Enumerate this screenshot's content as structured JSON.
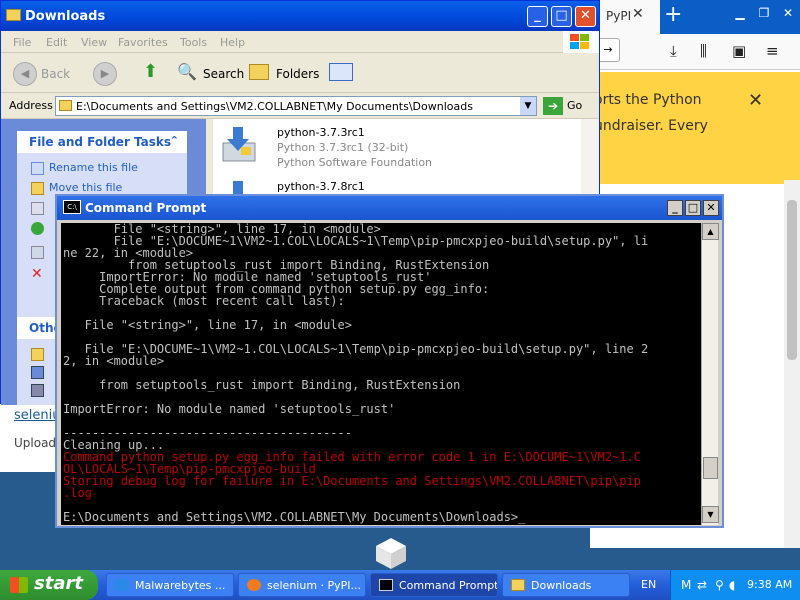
{
  "browser": {
    "tab_label": "PyPI",
    "banner_line1": "orts the Python",
    "banner_line2": "undraiser. Every",
    "link_text": "seleniu",
    "upload_text": "Uploade"
  },
  "explorer": {
    "title": "Downloads",
    "menu": [
      "File",
      "Edit",
      "View",
      "Favorites",
      "Tools",
      "Help"
    ],
    "toolbar": {
      "back": "Back",
      "search": "Search",
      "folders": "Folders"
    },
    "address_label": "Address",
    "address_value": "E:\\Documents and Settings\\VM2.COLLABNET\\My Documents\\Downloads",
    "go_label": "Go",
    "tasks_title": "File and Folder Tasks",
    "tasks": [
      "Rename this file",
      "Move this file"
    ],
    "other_title": "Othe",
    "files": [
      {
        "name": "python-3.7.3rc1",
        "desc": "Python 3.7.3rc1 (32-bit)",
        "publisher": "Python Software Foundation"
      },
      {
        "name": "python-3.7.8rc1",
        "desc": "",
        "publisher": ""
      }
    ]
  },
  "cmd": {
    "title": "Command Prompt",
    "lines": [
      {
        "t": "       File \"<string>\", line 17, in <module>",
        "c": "n"
      },
      {
        "t": "       File \"E:\\DOCUME~1\\VM2~1.COL\\LOCALS~1\\Temp\\pip-pmcxpjeo-build\\setup.py\", li",
        "c": "n"
      },
      {
        "t": "ne 22, in <module>",
        "c": "n"
      },
      {
        "t": "         from setuptools_rust import Binding, RustExtension",
        "c": "n"
      },
      {
        "t": "     ImportError: No module named 'setuptools_rust'",
        "c": "n"
      },
      {
        "t": "     Complete output from command python setup.py egg_info:",
        "c": "n"
      },
      {
        "t": "     Traceback (most recent call last):",
        "c": "n"
      },
      {
        "t": "",
        "c": "n"
      },
      {
        "t": "   File \"<string>\", line 17, in <module>",
        "c": "n"
      },
      {
        "t": "",
        "c": "n"
      },
      {
        "t": "   File \"E:\\DOCUME~1\\VM2~1.COL\\LOCALS~1\\Temp\\pip-pmcxpjeo-build\\setup.py\", line 2",
        "c": "n"
      },
      {
        "t": "2, in <module>",
        "c": "n"
      },
      {
        "t": "",
        "c": "n"
      },
      {
        "t": "     from setuptools_rust import Binding, RustExtension",
        "c": "n"
      },
      {
        "t": "",
        "c": "n"
      },
      {
        "t": "ImportError: No module named 'setuptools_rust'",
        "c": "n"
      },
      {
        "t": "",
        "c": "n"
      },
      {
        "t": "----------------------------------------",
        "c": "n"
      },
      {
        "t": "Cleaning up...",
        "c": "n"
      },
      {
        "t": "Command python setup.py egg_info failed with error code 1 in E:\\DOCUME~1\\VM2~1.C",
        "c": "e"
      },
      {
        "t": "OL\\LOCALS~1\\Temp\\pip-pmcxpjeo-build",
        "c": "e"
      },
      {
        "t": "Storing debug log for failure in E:\\Documents and Settings\\VM2.COLLABNET\\pip\\pip",
        "c": "e"
      },
      {
        "t": ".log",
        "c": "e"
      },
      {
        "t": "",
        "c": "n"
      },
      {
        "t": "E:\\Documents and Settings\\VM2.COLLABNET\\My Documents\\Downloads>_",
        "c": "n"
      }
    ]
  },
  "taskbar": {
    "start": "start",
    "tasks": [
      "Malwarebytes ...",
      "selenium · PyPI...",
      "Command Prompt",
      "Downloads"
    ],
    "lang": "EN",
    "clock": "9:38 AM"
  },
  "colors": {
    "xp_blue": "#0a5fe8",
    "error_red": "#c00000",
    "banner_yellow": "#ffd343"
  }
}
